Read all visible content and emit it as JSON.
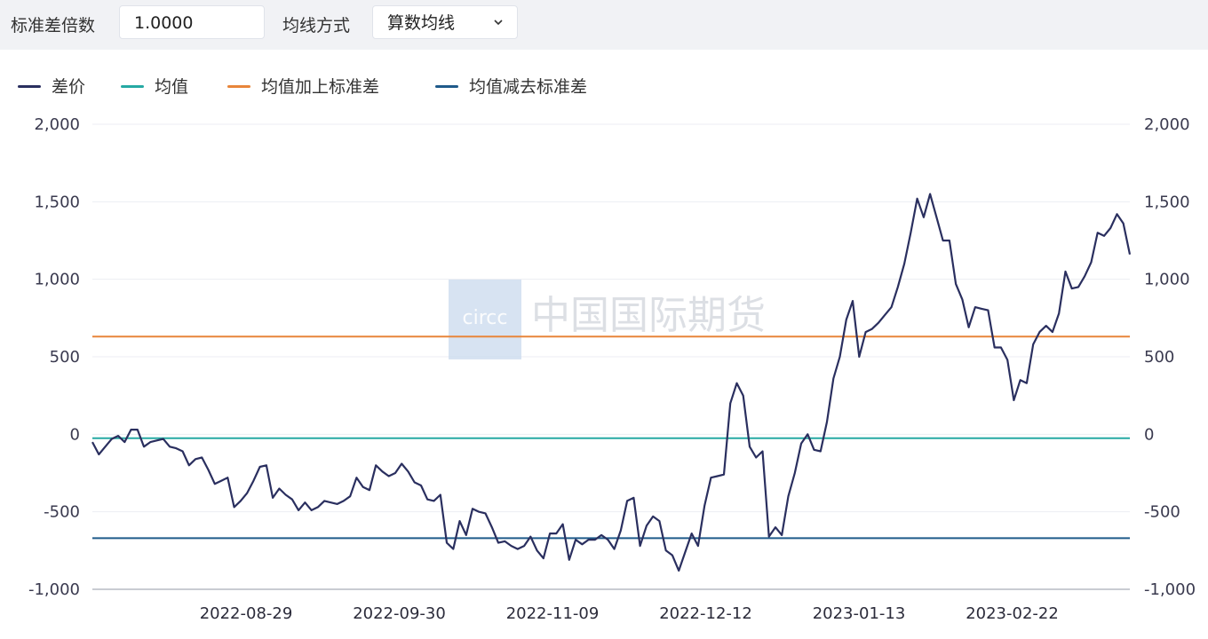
{
  "toolbar": {
    "std_multiplier_label": "标准差倍数",
    "std_multiplier_value": "1.0000",
    "ma_method_label": "均线方式",
    "ma_method_value": "算数均线"
  },
  "legend": [
    {
      "label": "差价",
      "color": "#2a2f5f"
    },
    {
      "label": "均值",
      "color": "#26a9a3"
    },
    {
      "label": "均值加上标准差",
      "color": "#e8853a"
    },
    {
      "label": "均值减去标准差",
      "color": "#1f5a8a"
    }
  ],
  "watermark": {
    "logo_text": "circc",
    "cn_text": "中国国际期货"
  },
  "chart_data": {
    "type": "line",
    "x_ticks": [
      "2022-08-29",
      "2022-09-30",
      "2022-11-09",
      "2022-12-12",
      "2023-01-13",
      "2023-02-22"
    ],
    "y_ticks": [
      -1000,
      -500,
      0,
      500,
      1000,
      1500,
      2000
    ],
    "y_tick_labels": [
      "-1,000",
      "-500",
      "0",
      "500",
      "1,000",
      "1,500",
      "2,000"
    ],
    "ylim": [
      -1000,
      2000
    ],
    "dual_y_axis": true,
    "grid": true,
    "series": [
      {
        "name": "均值",
        "type": "hline",
        "value": -25,
        "color": "#26a9a3"
      },
      {
        "name": "均值加上标准差",
        "type": "hline",
        "value": 630,
        "color": "#e8853a"
      },
      {
        "name": "均值减去标准差",
        "type": "hline",
        "value": -670,
        "color": "#1f5a8a"
      },
      {
        "name": "差价",
        "color": "#2a2f5f",
        "values": [
          -50,
          -130,
          -80,
          -30,
          -10,
          -50,
          30,
          30,
          -80,
          -50,
          -40,
          -30,
          -80,
          -90,
          -110,
          -200,
          -160,
          -150,
          -230,
          -320,
          -300,
          -280,
          -470,
          -430,
          -380,
          -300,
          -210,
          -200,
          -410,
          -350,
          -390,
          -420,
          -490,
          -440,
          -490,
          -470,
          -430,
          -440,
          -450,
          -430,
          -400,
          -280,
          -340,
          -360,
          -200,
          -240,
          -270,
          -250,
          -190,
          -240,
          -310,
          -330,
          -420,
          -430,
          -390,
          -700,
          -740,
          -560,
          -650,
          -480,
          -500,
          -510,
          -600,
          -700,
          -690,
          -720,
          -740,
          -720,
          -660,
          -750,
          -800,
          -640,
          -640,
          -580,
          -810,
          -680,
          -710,
          -680,
          -680,
          -650,
          -680,
          -740,
          -620,
          -430,
          -410,
          -720,
          -590,
          -530,
          -560,
          -750,
          -780,
          -880,
          -760,
          -640,
          -720,
          -460,
          -280,
          -270,
          -260,
          200,
          330,
          250,
          -80,
          -150,
          -110,
          -660,
          -600,
          -650,
          -400,
          -250,
          -60,
          0,
          -100,
          -110,
          80,
          360,
          500,
          740,
          860,
          500,
          660,
          680,
          720,
          770,
          820,
          950,
          1100,
          1300,
          1520,
          1400,
          1550,
          1400,
          1250,
          1250,
          970,
          870,
          690,
          820,
          810,
          800,
          560,
          560,
          480,
          220,
          350,
          330,
          580,
          660,
          700,
          660,
          780,
          1050,
          940,
          950,
          1020,
          1110,
          1300,
          1280,
          1330,
          1420,
          1360,
          1160
        ]
      }
    ]
  }
}
